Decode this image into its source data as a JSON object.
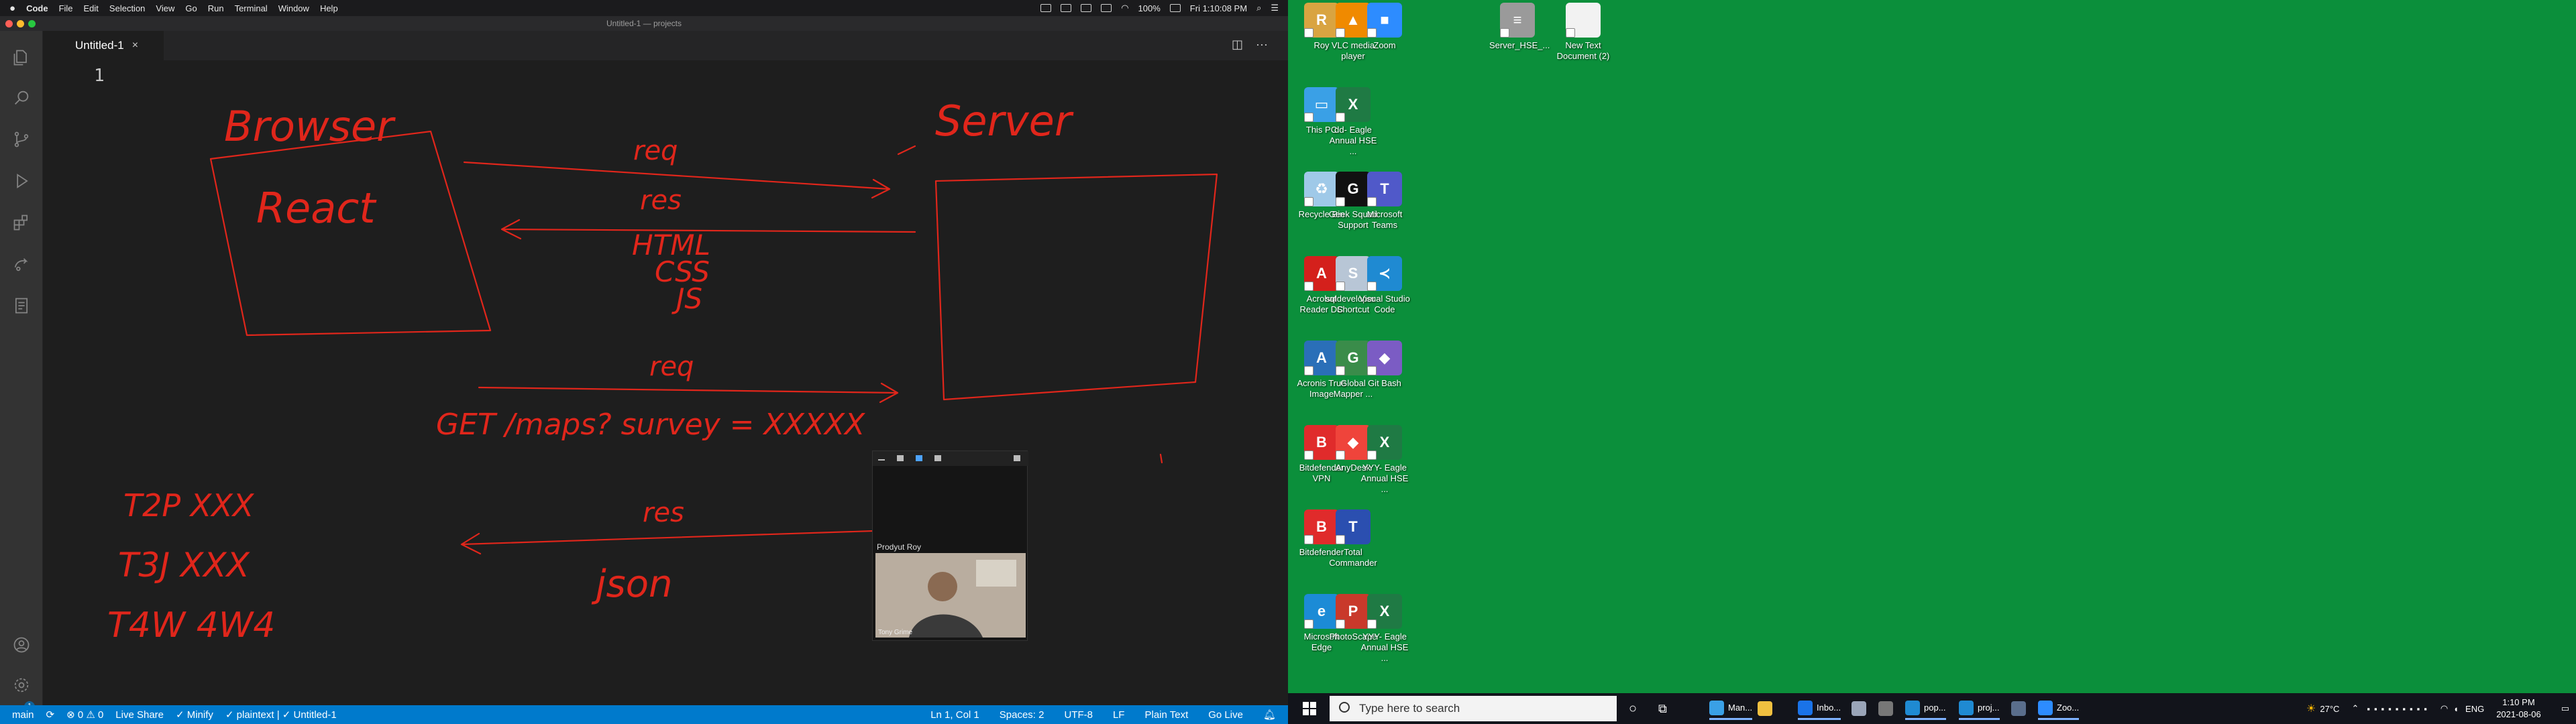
{
  "mac_menubar": {
    "app_name": "Code",
    "menus": [
      "File",
      "Edit",
      "Selection",
      "View",
      "Go",
      "Run",
      "Terminal",
      "Window",
      "Help"
    ],
    "battery": "100%",
    "clock": "Fri 1:10:08 PM"
  },
  "window": {
    "title": "Untitled-1 — projects"
  },
  "editor": {
    "tab_label": "Untitled-1",
    "tab_close": "×",
    "split_icon": "◫",
    "more_icon": "···",
    "line_number": "1"
  },
  "activity_bar": {
    "icons": [
      "explorer-icon",
      "search-icon",
      "source-control-icon",
      "run-debug-icon",
      "extensions-icon",
      "live-share-icon",
      "notebook-icon",
      "account-icon",
      "settings-gear-icon"
    ],
    "settings_badge": "1"
  },
  "drawing": {
    "color": "#e0261b",
    "texts": {
      "browser": "Browser",
      "server": "Server",
      "react": "React",
      "req1": "req",
      "res1": "res",
      "html": "HTML",
      "css": "CSS",
      "js": "JS",
      "req2": "req",
      "get": "GET /maps? survey = XXXXX",
      "t2p": "T2P XXX",
      "t3j": "T3J XXX",
      "t4w": "T4W 4W4",
      "res2": "res",
      "json": "json"
    }
  },
  "zoom_window": {
    "participant_name": "Prodyut Roy",
    "video_caption": "Tony Grime"
  },
  "statusbar": {
    "branch": "main",
    "sync_icon": "⟳",
    "problems": "⊗ 0 ⚠ 0",
    "live_share": "Live Share",
    "minify": "✓ Minify",
    "plaintext": "✓ plaintext | ✓ Untitled-1",
    "position": "Ln 1, Col 1",
    "spaces": "Spaces: 2",
    "encoding": "UTF-8",
    "eol": "LF",
    "language": "Plain Text",
    "go_live": "Go Live"
  },
  "desktop": {
    "icons": [
      {
        "label": "Roy",
        "color": "#d9a441",
        "glyph": "R"
      },
      {
        "label": "VLC media player",
        "color": "#f08a00",
        "glyph": "▲"
      },
      {
        "label": "Zoom",
        "color": "#2d8cff",
        "glyph": "■"
      },
      {
        "label": "Server_HSE_...",
        "color": "#9a9a9a",
        "glyph": "≡"
      },
      {
        "label": "New Text Document (2)",
        "color": "#f2f2f2",
        "glyph": ""
      },
      {
        "label": "This PC",
        "color": "#3aa0e6",
        "glyph": "▭"
      },
      {
        "label": "dd- Eagle Annual HSE ...",
        "color": "#1f7a44",
        "glyph": "X"
      },
      {
        "label": "Recycle Bin",
        "color": "#9fc9e8",
        "glyph": "♻"
      },
      {
        "label": "Geek Squad Support",
        "color": "#111111",
        "glyph": "G"
      },
      {
        "label": "Microsoft Teams",
        "color": "#5059c9",
        "glyph": "T"
      },
      {
        "label": "Acrobat Reader DC",
        "color": "#d4201c",
        "glyph": "A"
      },
      {
        "label": "sqldeveloper - Shortcut",
        "color": "#b8c6d6",
        "glyph": "S"
      },
      {
        "label": "Visual Studio Code",
        "color": "#1f8ad2",
        "glyph": "≺"
      },
      {
        "label": "Acronis True Image",
        "color": "#2a6fb8",
        "glyph": "A"
      },
      {
        "label": "Global Mapper ...",
        "color": "#3a8c4a",
        "glyph": "G"
      },
      {
        "label": "Git Bash",
        "color": "#7b5cc4",
        "glyph": "◆"
      },
      {
        "label": "Bitdefender VPN",
        "color": "#e02b2b",
        "glyph": "B"
      },
      {
        "label": "AnyDesk",
        "color": "#ef443b",
        "glyph": "◆"
      },
      {
        "label": "YYY- Eagle Annual HSE ...",
        "color": "#1f7a44",
        "glyph": "X"
      },
      {
        "label": "Bitdefender",
        "color": "#e02b2b",
        "glyph": "B"
      },
      {
        "label": "Total Commander",
        "color": "#2b4fb0",
        "glyph": "T"
      },
      {
        "label": "Microsoft Edge",
        "color": "#1c8bd6",
        "glyph": "e"
      },
      {
        "label": "PhotoScape",
        "color": "#c9392b",
        "glyph": "P"
      },
      {
        "label": "YYY- Eagle Annual HSE ...",
        "color": "#1f7a44",
        "glyph": "X"
      }
    ]
  },
  "taskbar": {
    "search_placeholder": "Type here to search",
    "apps": [
      {
        "label": "Man...",
        "color": "#3aa0e6"
      },
      {
        "label": "",
        "color": "#f0c040"
      },
      {
        "label": "Inbo...",
        "color": "#1a73e8"
      },
      {
        "label": "",
        "color": "#9aa5b8"
      },
      {
        "label": "",
        "color": "#777777"
      },
      {
        "label": "pop...",
        "color": "#1f8ad2"
      },
      {
        "label": "proj...",
        "color": "#1f8ad2"
      },
      {
        "label": "",
        "color": "#5a6e8c"
      },
      {
        "label": "Zoo...",
        "color": "#2d8cff"
      }
    ],
    "weather": "27°C",
    "language": "ENG",
    "time": "1:10 PM",
    "date": "2021-08-06"
  }
}
